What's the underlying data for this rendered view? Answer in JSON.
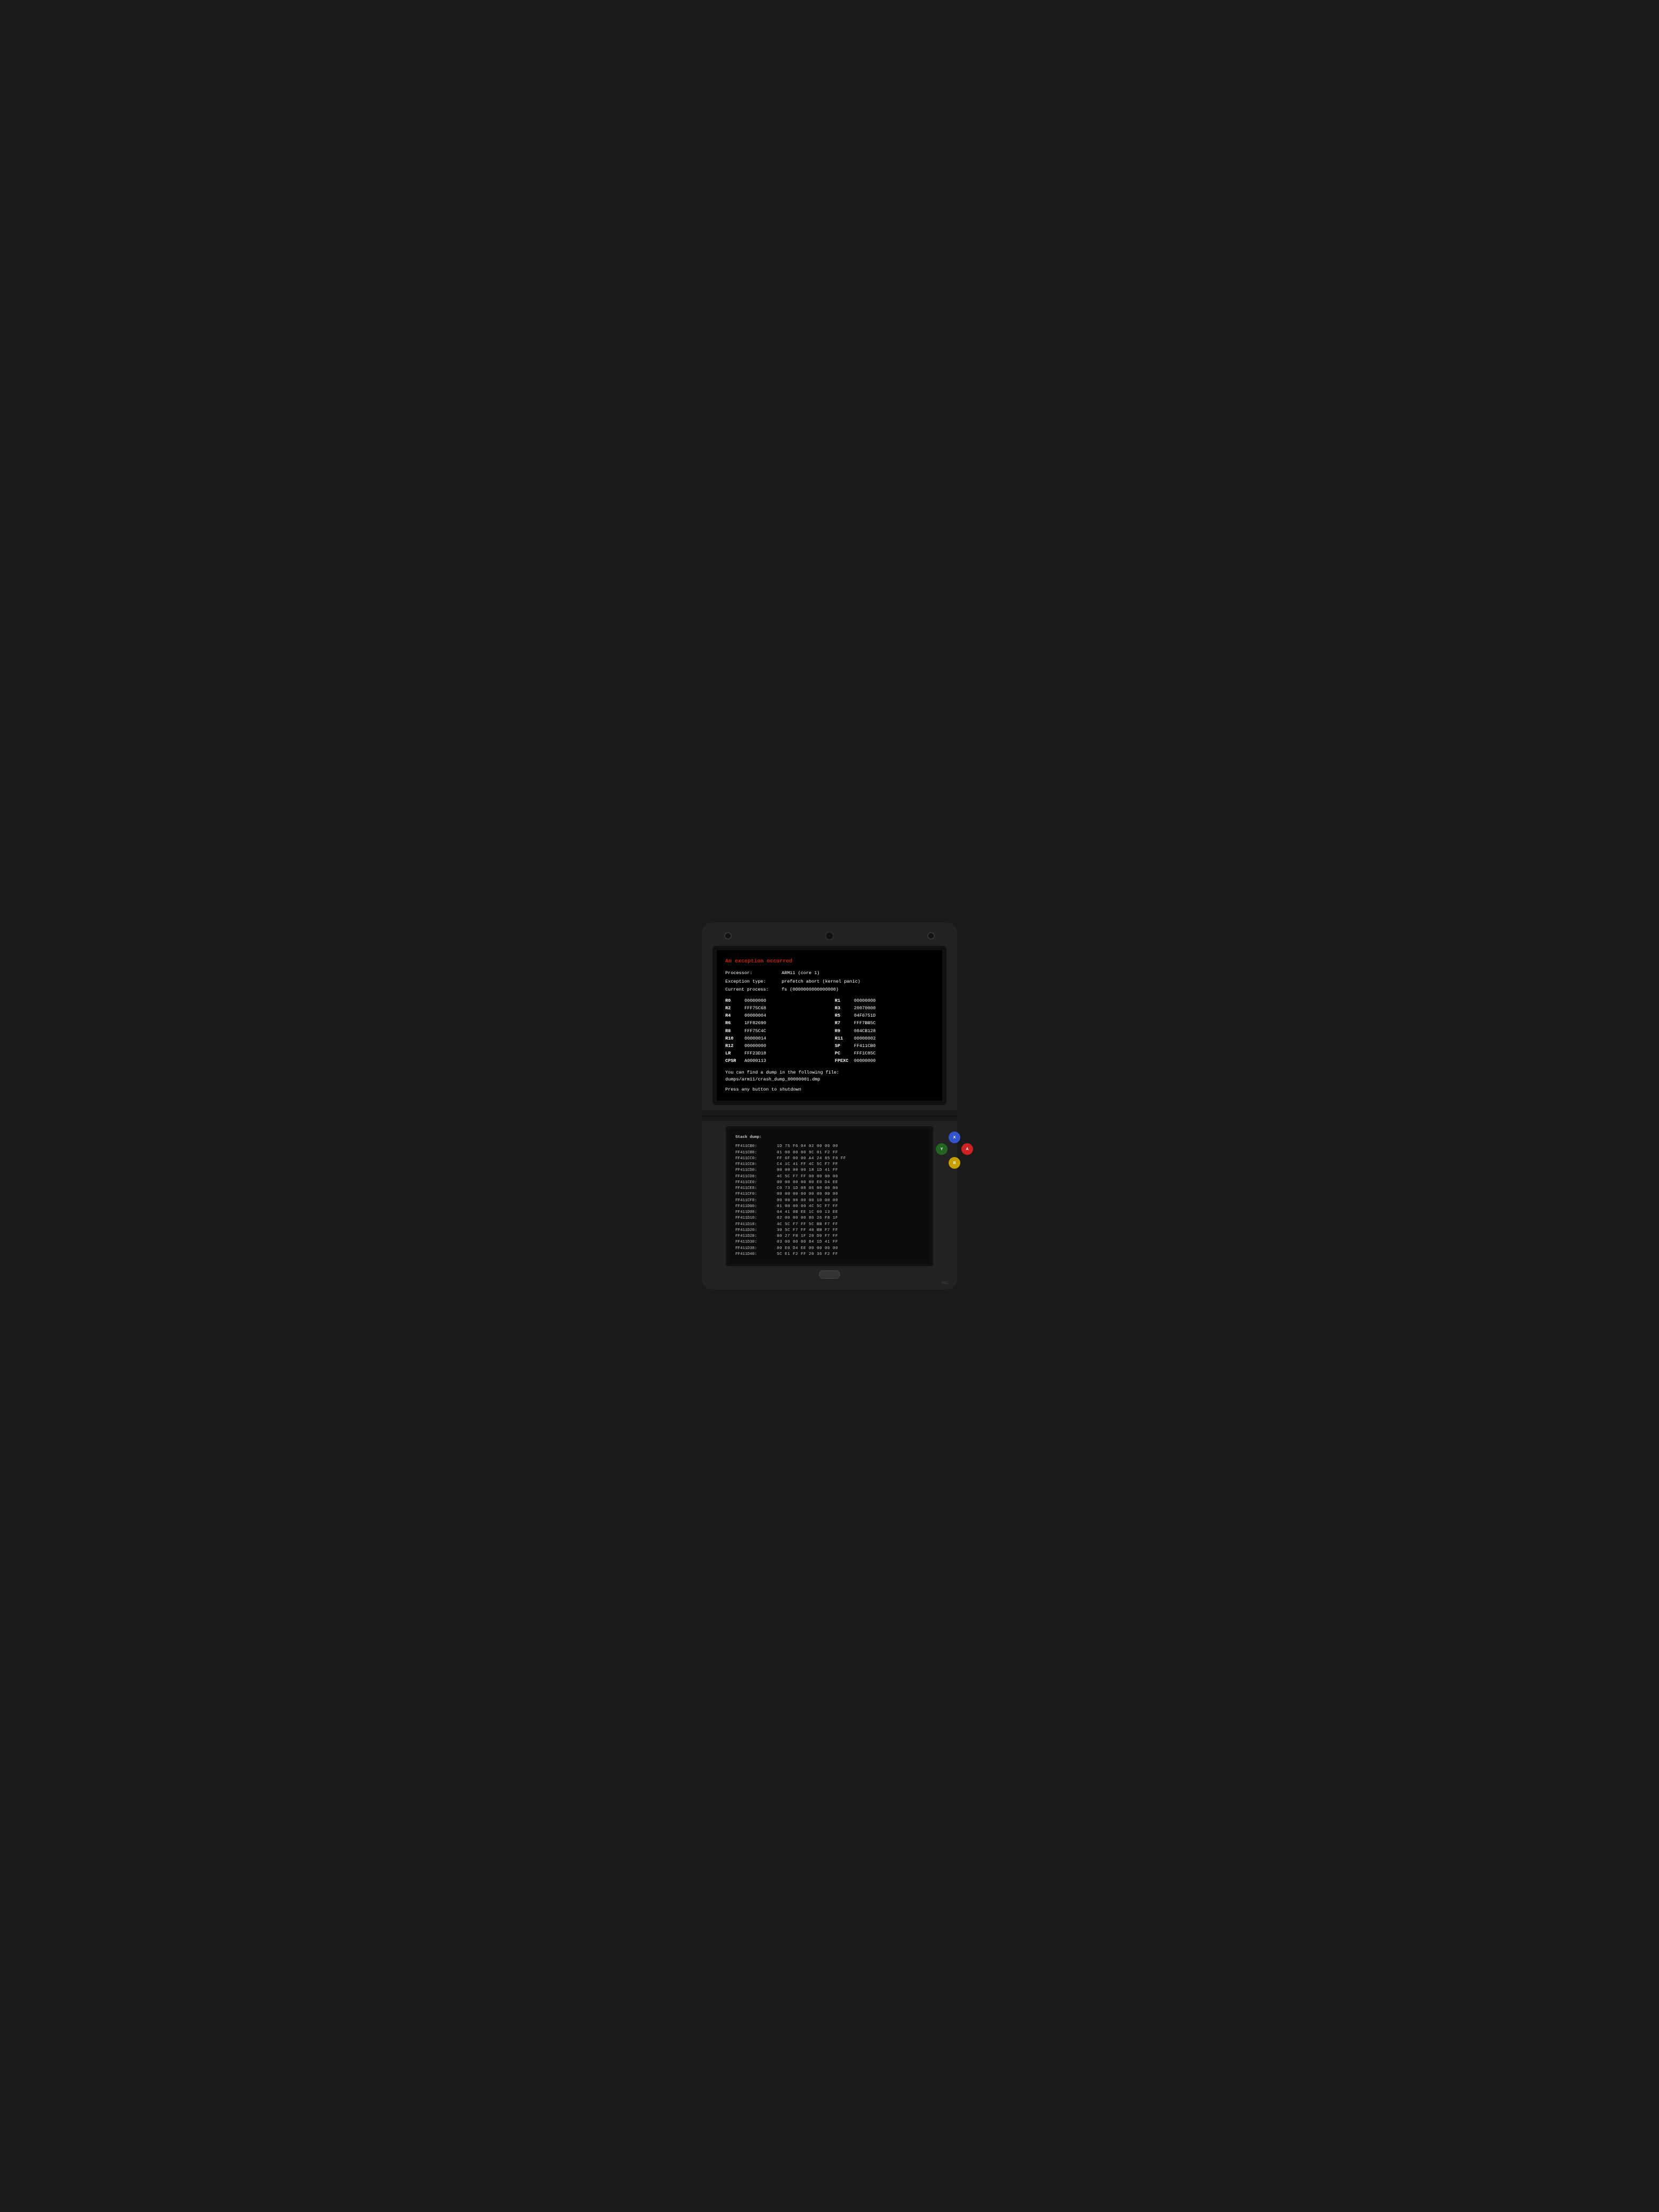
{
  "device": {
    "top_screen": {
      "error_title": "An exception occurred",
      "processor_label": "Processor:",
      "processor_value": "ARM11 (core 1)",
      "exception_label": "Exception type:",
      "exception_value": "prefetch abort (kernel panic)",
      "process_label": "Current process:",
      "process_value": "fs (0000000000000000)",
      "registers": [
        {
          "name": "R0",
          "value": "00000000",
          "name2": "R1",
          "value2": "00000000"
        },
        {
          "name": "R2",
          "value": "FFF75C68",
          "name2": "R3",
          "value2": "20070000"
        },
        {
          "name": "R4",
          "value": "00000004",
          "name2": "R5",
          "value2": "04F6751D"
        },
        {
          "name": "R6",
          "value": "1FF82690",
          "name2": "R7",
          "value2": "FFF7BB5C"
        },
        {
          "name": "R8",
          "value": "FFF75C4C",
          "name2": "R9",
          "value2": "084CB128"
        },
        {
          "name": "R10",
          "value": "00000014",
          "name2": "R11",
          "value2": "00000002"
        },
        {
          "name": "R12",
          "value": "00000000",
          "name2": "SP",
          "value2": "FF411CB0"
        },
        {
          "name": "LR",
          "value": "FFF23D18",
          "name2": "PC",
          "value2": "FFF1C85C"
        },
        {
          "name": "CPSR",
          "value": "A0000113",
          "name2": "FPEXC",
          "value2": "00000000"
        }
      ],
      "dump_text1": "You can find a dump in the following file:",
      "dump_text2": "dumps/arm11/crash_dump_00000001.dmp",
      "press_msg": "Press any button to shutdown"
    },
    "bottom_screen": {
      "title": "Stack dump:",
      "rows": [
        {
          "addr": "FF411CB0:",
          "vals": "1D 75 F6 04  02 00 00 00"
        },
        {
          "addr": "FF411CB8:",
          "vals": "01 00 00 00  9C 01 F2 FF"
        },
        {
          "addr": "FF411CC0:",
          "vals": "FF 6F 00 00  A4 24 85 F9 FF"
        },
        {
          "addr": "FF411CC8:",
          "vals": "C4 1C 41 FF  4C 5C F7 FF"
        },
        {
          "addr": "FF411CD0:",
          "vals": "00 00 00 00  18 1D 41 FF"
        },
        {
          "addr": "FF411CD8:",
          "vals": "4C 5C F7 FF  00 00 00 00"
        },
        {
          "addr": "FF411CE0:",
          "vals": "00 00 00 00  80 E0 D4 EE"
        },
        {
          "addr": "FF411CE8:",
          "vals": "C0 73 1D 08  06 00 00 00"
        },
        {
          "addr": "FF411CF0:",
          "vals": "00 00 00 00  00 00 00 00"
        },
        {
          "addr": "FF411CF8:",
          "vals": "00 00 00 00  00 10 00 00"
        },
        {
          "addr": "FF411D00:",
          "vals": "01 00 00 00  4C 5C F7 FF"
        },
        {
          "addr": "FF411D08:",
          "vals": "04 41 0B EE  1C 60 13 EE"
        },
        {
          "addr": "FF411D10:",
          "vals": "02 00 00 00  80 26 F8 1F"
        },
        {
          "addr": "FF411D18:",
          "vals": "4C 5C F7 FF  5C BB F7 FF"
        },
        {
          "addr": "FF411D20:",
          "vals": "30 5C F7 FF  40 BB F7 FF"
        },
        {
          "addr": "FF411D28:",
          "vals": "80 27 F8 1F  20 D0 F7 FF"
        },
        {
          "addr": "FF411D30:",
          "vals": "03 00 00 00  84 1D 41 FF"
        },
        {
          "addr": "FF411D38:",
          "vals": "80 E0 D4 EE  00 00 00 00"
        },
        {
          "addr": "FF411D40:",
          "vals": "5C E1 F2 FF  20 36 F2 FF"
        }
      ]
    },
    "buttons": {
      "a": "A",
      "b": "B",
      "x": "X",
      "y": "Y"
    }
  }
}
